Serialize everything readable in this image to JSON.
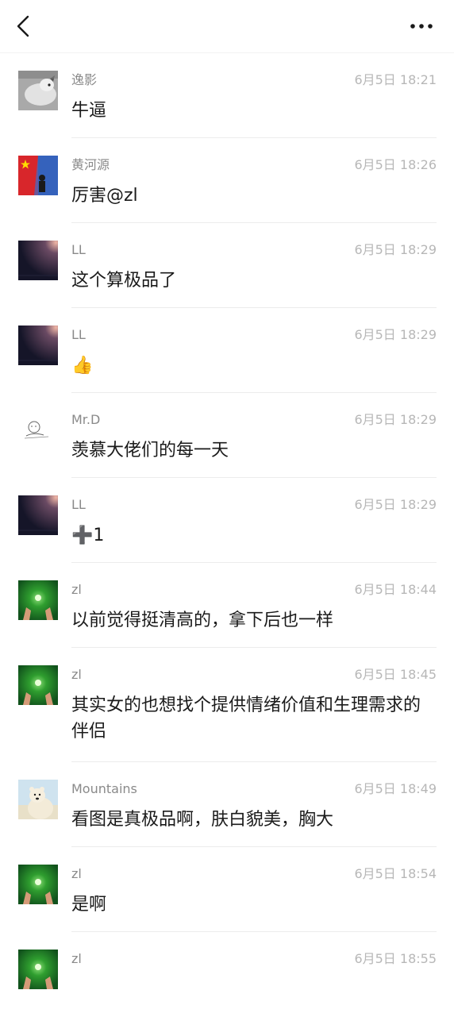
{
  "header": {
    "back_icon": "chevron-left-icon",
    "more_icon": "ellipsis-icon"
  },
  "comments": [
    {
      "name": "逸影",
      "time": "6月5日 18:21",
      "text": "牛逼",
      "avatar": "avatar-cat"
    },
    {
      "name": "黄河源",
      "time": "6月5日 18:26",
      "text": "厉害@zl",
      "avatar": "avatar-flag"
    },
    {
      "name": "LL",
      "time": "6月5日 18:29",
      "text": "这个算极品了",
      "avatar": "avatar-dark-sky"
    },
    {
      "name": "LL",
      "time": "6月5日 18:29",
      "text": "👍",
      "avatar": "avatar-dark-sky"
    },
    {
      "name": "Mr.D",
      "time": "6月5日 18:29",
      "text": "羡慕大佬们的每一天",
      "avatar": "avatar-sketch"
    },
    {
      "name": "LL",
      "time": "6月5日 18:29",
      "text": "➕1",
      "avatar": "avatar-dark-sky"
    },
    {
      "name": "zl",
      "time": "6月5日 18:44",
      "text": "以前觉得挺清高的，拿下后也一样",
      "avatar": "avatar-green"
    },
    {
      "name": "zl",
      "time": "6月5日 18:45",
      "text": "其实女的也想找个提供情绪价值和生理需求的伴侣",
      "avatar": "avatar-green"
    },
    {
      "name": "Mountains",
      "time": "6月5日 18:49",
      "text": "看图是真极品啊，肤白貌美，胸大",
      "avatar": "avatar-bear"
    },
    {
      "name": "zl",
      "time": "6月5日 18:54",
      "text": "是啊",
      "avatar": "avatar-green"
    },
    {
      "name": "zl",
      "time": "6月5日 18:55",
      "text": "",
      "avatar": "avatar-green"
    }
  ]
}
